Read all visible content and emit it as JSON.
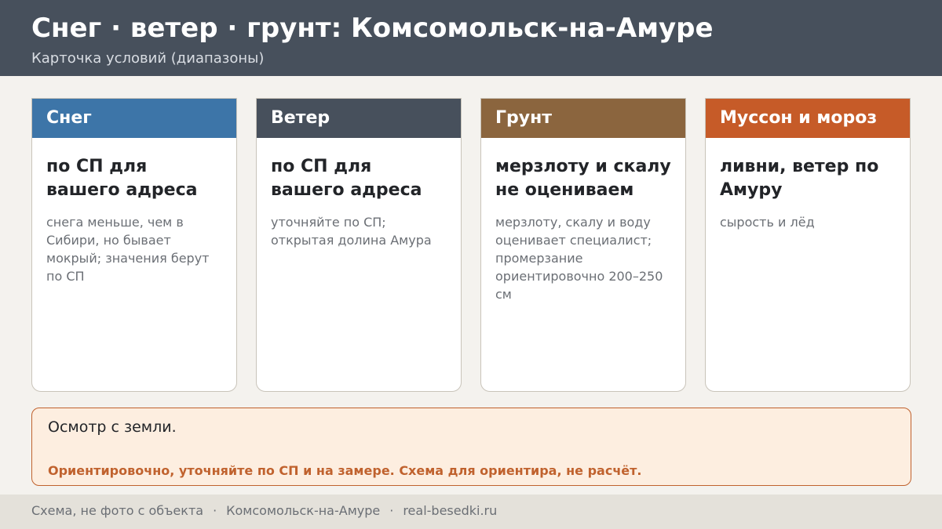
{
  "header": {
    "title": "Снег · ветер · грунт: Комсомольск-на-Амуре",
    "subtitle": "Карточка условий (диапазоны)"
  },
  "cards": [
    {
      "label": "Снег",
      "color": "#3d75a8",
      "main": "по СП для вашего адреса",
      "note": "снега меньше, чем в Сибири, но бывает мокрый; значения берут по СП"
    },
    {
      "label": "Ветер",
      "color": "#47505c",
      "main": "по СП для вашего адреса",
      "note": "уточняйте по СП; открытая долина Амура"
    },
    {
      "label": "Грунт",
      "color": "#8b653e",
      "main": "мерзлоту и скалу не оцениваем",
      "note": "мерзлоту, скалу и воду оценивает специалист; промерзание ориентировочно 200–250 см"
    },
    {
      "label": "Муссон и мороз",
      "color": "#c65b28",
      "main": "ливни, ветер по Амуру",
      "note": "сырость и лёд"
    }
  ],
  "notice": {
    "main": "Осмотр с земли.",
    "warning": "Ориентировочно, уточняйте по СП и на замере. Схема для ориентира, не расчёт."
  },
  "footer": {
    "items": [
      "Схема, не фото с объекта",
      "Комсомольск-на-Амуре",
      "real-besedki.ru"
    ],
    "separator": "·"
  }
}
